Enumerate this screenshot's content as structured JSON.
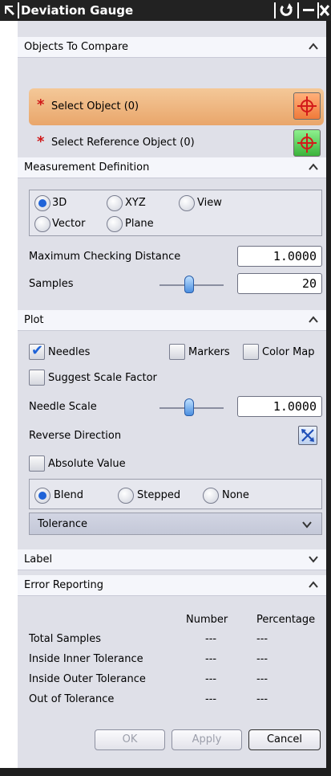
{
  "window": {
    "title": "Deviation Gauge",
    "controls": [
      "reset-icon",
      "minimize-icon",
      "close-icon"
    ]
  },
  "sections": {
    "objects": {
      "title": "Objects To Compare",
      "select_object": "Select Object (0)",
      "select_reference": "Select Reference Object (0)"
    },
    "measurement": {
      "title": "Measurement Definition",
      "options": [
        "3D",
        "XYZ",
        "View",
        "Vector",
        "Plane"
      ],
      "selected": "3D",
      "max_distance_label": "Maximum Checking Distance",
      "max_distance_value": "1.0000",
      "samples_label": "Samples",
      "samples_value": "20",
      "samples_slider_level": 0.45
    },
    "plot": {
      "title": "Plot",
      "needles_label": "Needles",
      "needles_checked": true,
      "markers_label": "Markers",
      "markers_checked": false,
      "colormap_label": "Color Map",
      "colormap_checked": false,
      "suggest_label": "Suggest Scale Factor",
      "suggest_checked": false,
      "needle_scale_label": "Needle Scale",
      "needle_scale_value": "1.0000",
      "needle_scale_slider_level": 0.45,
      "reverse_label": "Reverse Direction",
      "absolute_label": "Absolute Value",
      "absolute_checked": false,
      "style_options": [
        "Blend",
        "Stepped",
        "None"
      ],
      "style_selected": "Blend",
      "tolerance_label": "Tolerance"
    },
    "label": {
      "title": "Label"
    },
    "error": {
      "title": "Error Reporting",
      "columns": [
        "Number",
        "Percentage"
      ],
      "rows": [
        {
          "name": "Total Samples",
          "number": "---",
          "percentage": "---"
        },
        {
          "name": "Inside Inner Tolerance",
          "number": "---",
          "percentage": "---"
        },
        {
          "name": "Inside Outer Tolerance",
          "number": "---",
          "percentage": "---"
        },
        {
          "name": "Out of Tolerance",
          "number": "---",
          "percentage": "---"
        }
      ]
    }
  },
  "buttons": {
    "ok": "OK",
    "apply": "Apply",
    "cancel": "Cancel"
  },
  "colors": {
    "accent": "#1f63d8",
    "active_row": "#eeb07a",
    "crosshair": "#e0201a"
  }
}
